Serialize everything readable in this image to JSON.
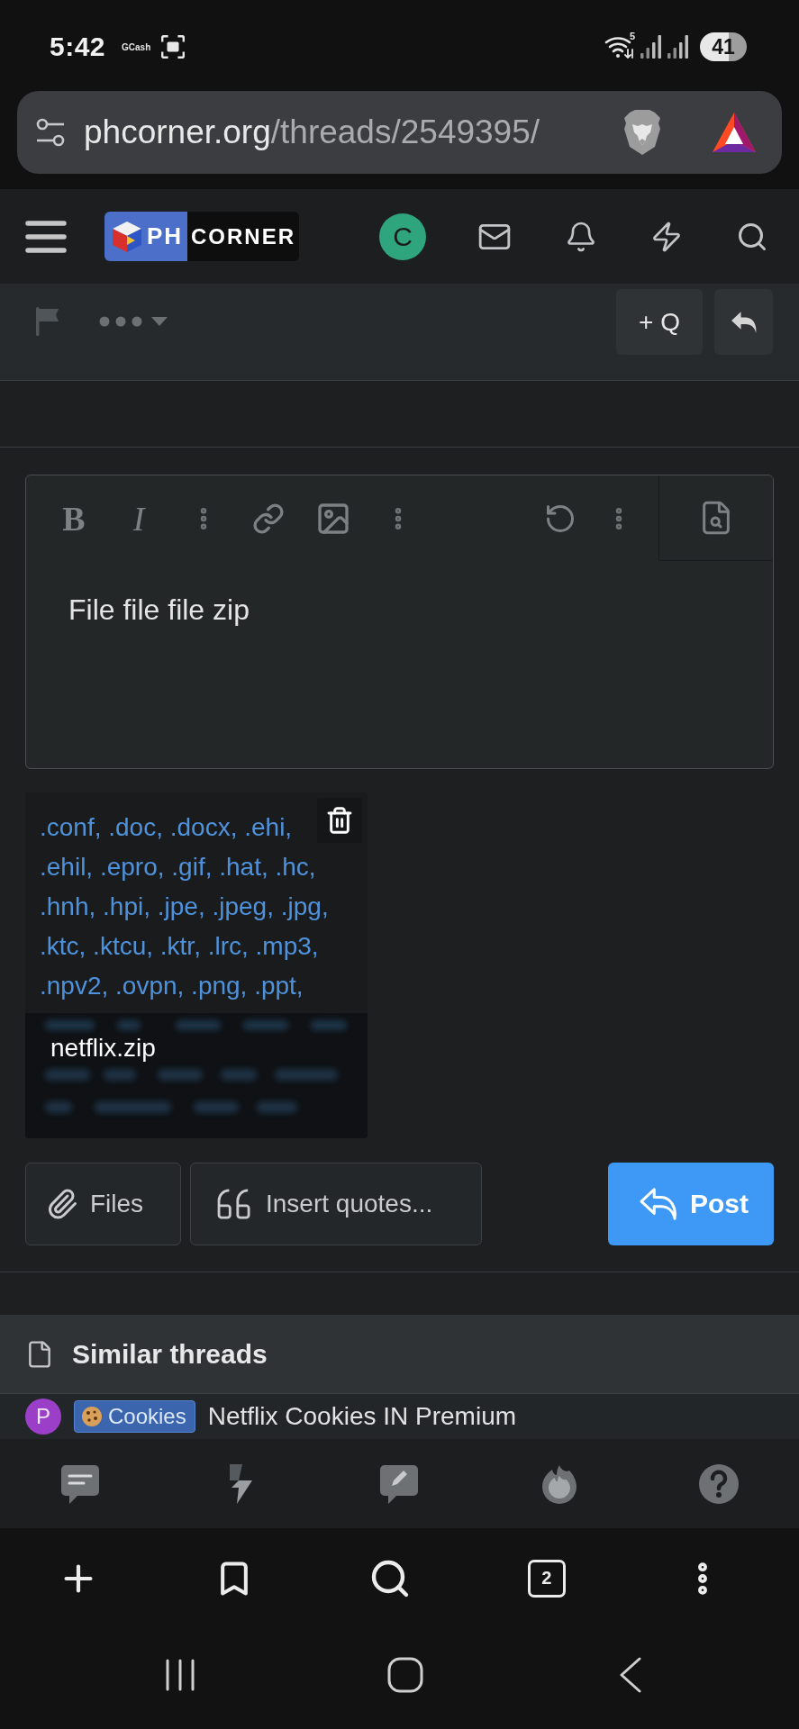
{
  "status_bar": {
    "time": "5:42",
    "notification": "GCash",
    "wifi_band": "5",
    "battery": "41"
  },
  "address_bar": {
    "domain": "phcorner.org",
    "path": "/threads/2549395/"
  },
  "site_header": {
    "logo_left": "PH",
    "logo_right": "CORNER",
    "avatar_letter": "C"
  },
  "thread_tools": {
    "multiquote": "+ Q"
  },
  "editor": {
    "format_buttons": [
      {
        "kind": "bold",
        "label": "B"
      },
      {
        "kind": "italic",
        "label": "I"
      }
    ],
    "text": "File file file zip"
  },
  "attachment": {
    "preview_lines": [
      ".conf, .doc, .docx, .ehi,",
      ".ehil, .epro, .gif, .hat, .hc,",
      ".hnh, .hpi, .jpe, .jpeg, .jpg,",
      ".ktc, .ktcu, .ktr, .lrc, .mp3,",
      ".npv2, .ovpn, .png, .ppt,"
    ],
    "filename": "netflix.zip"
  },
  "actions": {
    "files": "Files",
    "insert_quotes": "Insert quotes...",
    "post": "Post"
  },
  "similar_threads": {
    "title": "Similar threads",
    "threads": [
      {
        "avatar_letter": "P",
        "color": "#9b3fc9",
        "tag": "Cookies",
        "title": "Netflix Cookies IN Premium"
      }
    ]
  },
  "browser_toolbar": {
    "tab_count": "2"
  }
}
